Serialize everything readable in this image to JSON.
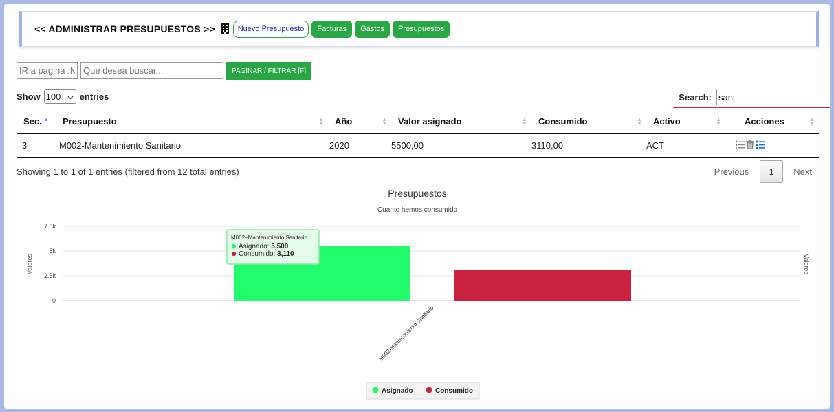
{
  "header": {
    "title": "<< ADMINISTRAR PRESUPUESTOS >>",
    "buttons": {
      "nuevo": "Nuevo Presupuesto",
      "facturas": "Facturas",
      "gastos": "Gastos",
      "presupuestos": "Presupuestos"
    }
  },
  "toolbar": {
    "page_placeholder": "IR a pagina :N",
    "search_placeholder": "Que desea buscar...",
    "filter_label": "PAGINAR / FILTRAR [F]"
  },
  "table_controls": {
    "show_label": "Show",
    "show_value": "100",
    "entries_label": "entries",
    "search_label": "Search:",
    "search_value": "sani"
  },
  "table": {
    "columns": [
      "Sec.",
      "Presupuesto",
      "Año",
      "Valor asignado",
      "Consumido",
      "Activo",
      "Acciones"
    ],
    "rows": [
      {
        "sec": "3",
        "presupuesto": "M002-Mantenimiento Sanitario",
        "anio": "2020",
        "valor": "5500,00",
        "consumido": "3110,00",
        "activo": "ACT"
      }
    ]
  },
  "pagination": {
    "info": "Showing 1 to 1 of 1 entries (filtered from 12 total entries)",
    "previous": "Previous",
    "page": "1",
    "next": "Next"
  },
  "chart_data": {
    "type": "bar",
    "title": "Presupuestos",
    "subtitle": "Cuanto hemos consumido",
    "ylabel": "Valores",
    "ylabel_right": "Valores",
    "categories": [
      "M002-Mantenimiento Sanitario"
    ],
    "series": [
      {
        "name": "Asignado",
        "values": [
          5500
        ],
        "color": "#22fb6c"
      },
      {
        "name": "Consumido",
        "values": [
          3110
        ],
        "color": "#c9233f"
      }
    ],
    "yticks": [
      "0",
      "2.5k",
      "5k",
      "7.5k"
    ],
    "ylim": [
      0,
      7500
    ],
    "legend": "bottom-center",
    "tooltip": {
      "title": "M002−Mantenimiento Sanitario",
      "lines": [
        {
          "label": "Asignado:",
          "value": "5,500"
        },
        {
          "label": "Consumido:",
          "value": "3,110"
        }
      ]
    }
  }
}
